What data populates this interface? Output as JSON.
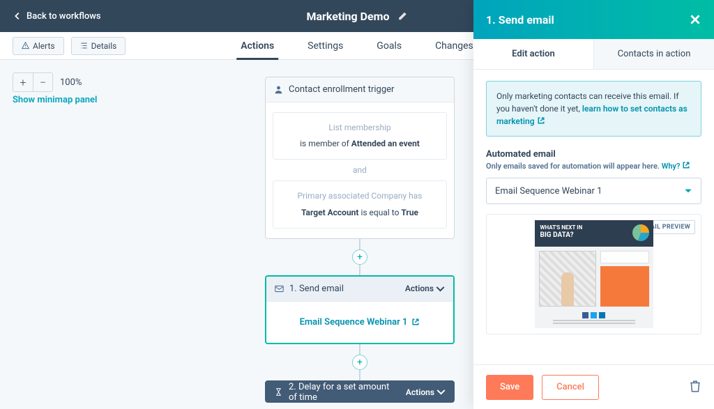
{
  "header": {
    "back_label": "Back to workflows",
    "title": "Marketing Demo"
  },
  "subbar": {
    "alerts": "Alerts",
    "details": "Details",
    "tabs": [
      "Actions",
      "Settings",
      "Goals",
      "Changes"
    ]
  },
  "zoom": {
    "level": "100%",
    "minimap_link": "Show minimap panel"
  },
  "trigger": {
    "head": "Contact enrollment trigger",
    "crit1_label": "List membership",
    "crit1_text_a": "is member of ",
    "crit1_text_b": "Attended an event",
    "join": "and",
    "crit2_label": "Primary associated Company has",
    "crit2_field": "Target Account",
    "crit2_mid": " is equal to ",
    "crit2_val": "True"
  },
  "step1": {
    "title": "1. Send email",
    "actions": "Actions",
    "email_name": "Email Sequence Webinar 1"
  },
  "step2": {
    "title": "2. Delay for a set amount of time",
    "actions": "Actions"
  },
  "panel": {
    "title": "1. Send email",
    "tab_edit": "Edit action",
    "tab_contacts": "Contacts in action",
    "info_a": "Only marketing contacts can receive this email. If you haven't done it yet, ",
    "info_link": "learn how to set contacts as marketing",
    "section_label": "Automated email",
    "section_help": "Only emails saved for automation will appear here. ",
    "section_help_link": "Why?",
    "selected_email": "Email Sequence Webinar 1",
    "preview_badge": "EMAIL PREVIEW",
    "preview_headline_a": "WHAT'S NEXT IN",
    "preview_headline_b": "BIG DATA?",
    "save": "Save",
    "cancel": "Cancel"
  }
}
